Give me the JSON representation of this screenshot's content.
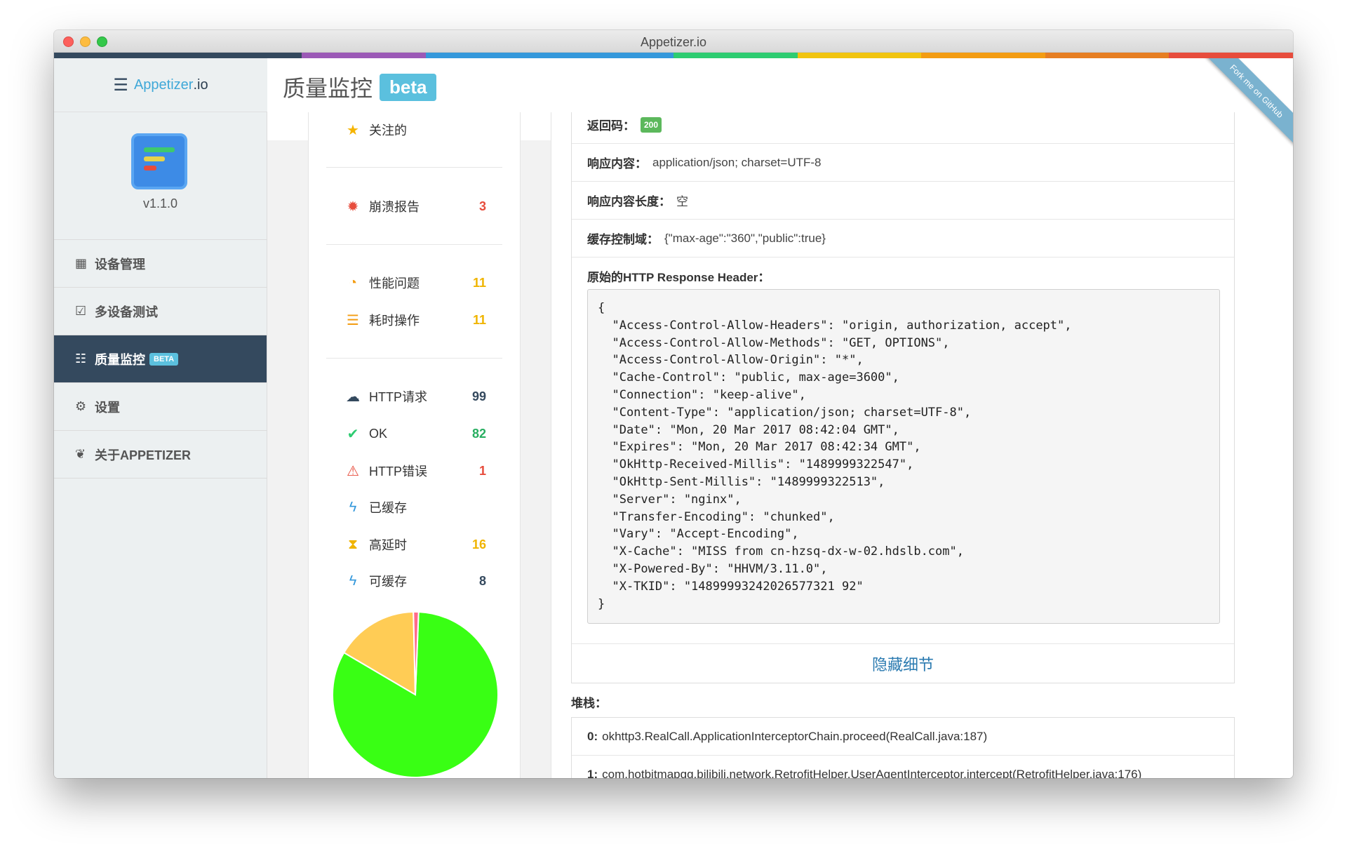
{
  "window": {
    "title": "Appetizer.io"
  },
  "colors": {
    "colorbar": [
      "#34495e",
      "#34495e",
      "#9b59b6",
      "#3498db",
      "#3498db",
      "#2ecc71",
      "#f1c40f",
      "#f39c12",
      "#e67e22",
      "#e74c3c"
    ]
  },
  "brand": {
    "name_part1": "Appetizer",
    "name_part2": ".io"
  },
  "header": {
    "title": "质量监控",
    "badge": "beta"
  },
  "ribbon": {
    "text": "Fork me on GitHub"
  },
  "sidebar": {
    "version": "v1.1.0",
    "items": [
      {
        "label": "设备管理",
        "icon": "grid-icon"
      },
      {
        "label": "多设备测试",
        "icon": "checkbox-icon"
      },
      {
        "label": "质量监控",
        "icon": "list-icon",
        "badge": "BETA",
        "active": true
      },
      {
        "label": "设置",
        "icon": "gear-icon"
      },
      {
        "label": "关于APPETIZER",
        "icon": "leaf-icon"
      }
    ]
  },
  "stats": {
    "starred": {
      "label": "关注的",
      "count": ""
    },
    "crash": {
      "label": "崩溃报告",
      "count": "3"
    },
    "perf": {
      "label": "性能问题",
      "count": "11"
    },
    "slow": {
      "label": "耗时操作",
      "count": "11"
    },
    "http": {
      "label": "HTTP请求",
      "count": "99"
    },
    "ok": {
      "label": "OK",
      "count": "82"
    },
    "httperr": {
      "label": "HTTP错误",
      "count": "1"
    },
    "cached": {
      "label": "已缓存",
      "count": ""
    },
    "latency": {
      "label": "高延时",
      "count": "16"
    },
    "cacheable": {
      "label": "可缓存",
      "count": "8"
    }
  },
  "pie": {
    "slices": [
      {
        "name": "OK",
        "value": 82,
        "color": "#39ff14"
      },
      {
        "name": "高延时",
        "value": 16,
        "color": "#ffcc55"
      },
      {
        "name": "HTTP错误",
        "value": 1,
        "color": "#ff6b8a"
      }
    ]
  },
  "detail": {
    "status_label": "返回码：",
    "status_value": "200",
    "content_type_label": "响应内容：",
    "content_type_value": "application/json; charset=UTF-8",
    "content_length_label": "响应内容长度：",
    "content_length_value": "空",
    "cache_control_label": "缓存控制域：",
    "cache_control_value": "{\"max-age\":\"360\",\"public\":true}",
    "raw_header_title": "原始的HTTP Response Header：",
    "raw_header": "{\n  \"Access-Control-Allow-Headers\": \"origin, authorization, accept\",\n  \"Access-Control-Allow-Methods\": \"GET, OPTIONS\",\n  \"Access-Control-Allow-Origin\": \"*\",\n  \"Cache-Control\": \"public, max-age=3600\",\n  \"Connection\": \"keep-alive\",\n  \"Content-Type\": \"application/json; charset=UTF-8\",\n  \"Date\": \"Mon, 20 Mar 2017 08:42:04 GMT\",\n  \"Expires\": \"Mon, 20 Mar 2017 08:42:34 GMT\",\n  \"OkHttp-Received-Millis\": \"1489999322547\",\n  \"OkHttp-Sent-Millis\": \"1489999322513\",\n  \"Server\": \"nginx\",\n  \"Transfer-Encoding\": \"chunked\",\n  \"Vary\": \"Accept-Encoding\",\n  \"X-Cache\": \"MISS from cn-hzsq-dx-w-02.hdslb.com\",\n  \"X-Powered-By\": \"HHVM/3.11.0\",\n  \"X-TKID\": \"14899993242026577321 92\"\n}",
    "hide_details": "隐藏细节"
  },
  "stack": {
    "title": "堆栈：",
    "frames": [
      {
        "index": "0:",
        "text": "okhttp3.RealCall.ApplicationInterceptorChain.proceed(RealCall.java:187)"
      },
      {
        "index": "1:",
        "text": "com.hotbitmapgg.bilibili.network.RetrofitHelper.UserAgentInterceptor.intercept(RetrofitHelper.java:176)"
      }
    ]
  }
}
